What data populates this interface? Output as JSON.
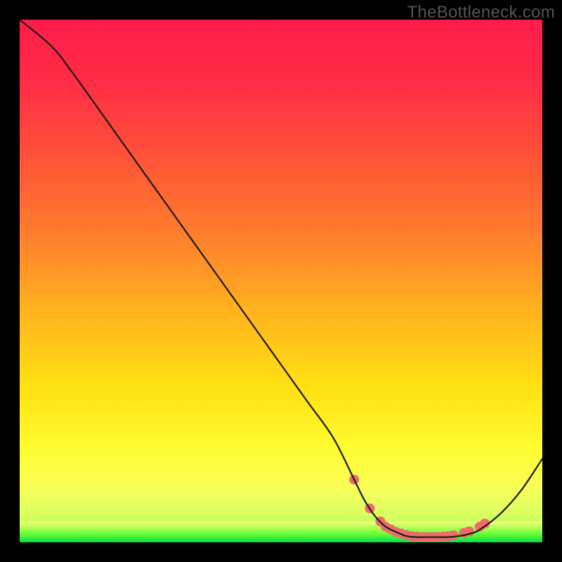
{
  "watermark": "TheBottleneck.com",
  "chart_data": {
    "type": "line",
    "title": "",
    "xlabel": "",
    "ylabel": "",
    "xlim": [
      0,
      100
    ],
    "ylim": [
      0,
      100
    ],
    "grid": false,
    "legend_position": "none",
    "series": [
      {
        "name": "curve",
        "x": [
          0,
          6,
          10,
          20,
          30,
          40,
          50,
          55,
          60,
          64,
          66,
          68,
          70,
          72,
          74,
          76,
          78,
          80,
          82,
          84,
          86,
          88,
          92,
          96,
          100
        ],
        "y": [
          100,
          95,
          90,
          76,
          62,
          48,
          34,
          27,
          20,
          12,
          8,
          5,
          3,
          2,
          1.2,
          1.0,
          1.0,
          1.0,
          1.0,
          1.2,
          1.6,
          2.4,
          5.5,
          10,
          16
        ],
        "stroke": "#1a1a1a",
        "stroke_width": 2.2
      }
    ],
    "markers": {
      "name": "valley-dots",
      "x": [
        64,
        67,
        69,
        70,
        71,
        72,
        73,
        74,
        75,
        76,
        77,
        78,
        79,
        80,
        81,
        82,
        83,
        85,
        86,
        88,
        89
      ],
      "y": [
        12,
        6.5,
        4,
        3,
        2.5,
        2,
        1.7,
        1.4,
        1.2,
        1.1,
        1.05,
        1.02,
        1.02,
        1.05,
        1.1,
        1.2,
        1.35,
        1.8,
        2.1,
        3.0,
        3.6
      ],
      "color": "#ef6a6a",
      "radius": 7
    },
    "green_band": {
      "y_from": 0,
      "y_to": 4,
      "colors": [
        "#00e040",
        "#76ff3a",
        "#f6ff7a"
      ]
    },
    "background_gradient": {
      "stops": [
        {
          "offset": 0.0,
          "color": "#ff1b4b"
        },
        {
          "offset": 0.12,
          "color": "#ff2d45"
        },
        {
          "offset": 0.25,
          "color": "#ff4f39"
        },
        {
          "offset": 0.4,
          "color": "#ff7a2e"
        },
        {
          "offset": 0.55,
          "color": "#ffb01f"
        },
        {
          "offset": 0.7,
          "color": "#ffe012"
        },
        {
          "offset": 0.82,
          "color": "#fffc30"
        },
        {
          "offset": 0.9,
          "color": "#f7ff5a"
        },
        {
          "offset": 0.95,
          "color": "#d7ff60"
        },
        {
          "offset": 1.0,
          "color": "#88ff46"
        }
      ]
    }
  }
}
